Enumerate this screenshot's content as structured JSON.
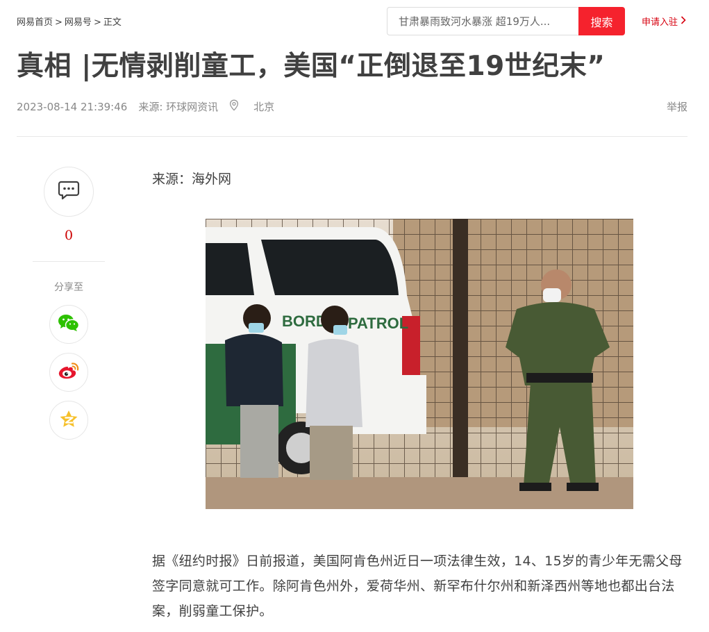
{
  "breadcrumb": {
    "home": "网易首页",
    "sep1": ">",
    "section": "网易号",
    "sep2": ">",
    "current": "正文"
  },
  "search": {
    "placeholder": "甘肃暴雨致河水暴涨 超19万人...",
    "button_label": "搜索"
  },
  "header": {
    "apply_label": "申请入驻",
    "apply_icon": "chevron-right-icon"
  },
  "article": {
    "title": "真相 |无情剥削童工，美国“正倒退至19世纪末”",
    "datetime": "2023-08-14 21:39:46",
    "source_meta": "来源: 环球网资讯",
    "location": "北京",
    "report_label": "举报",
    "source_line": "来源：海外网",
    "paragraph": "据《纽约时报》日前报道，美国阿肯色州近日一项法律生效，14、15岁的青少年无需父母签字同意就可工作。除阿肯色州外，爱荷华州、新罕布什尔州和新泽西州等地也都出台法案，削弱童工保护。"
  },
  "photo": {
    "vehicle_text": "BORDER PATROL",
    "vehicle_text_partial_left": "BORD",
    "vehicle_text_partial_right": "PATROL"
  },
  "sidebar": {
    "comment_count": "0",
    "share_label": "分享至",
    "share_icons": [
      "wechat-icon",
      "weibo-icon",
      "qzone-icon"
    ]
  },
  "colors": {
    "accent_red": "#f5222d",
    "apply_red": "#d7000f",
    "count_red": "#cc0000",
    "wechat_green": "#2dc100",
    "weibo_red": "#e6162d",
    "qzone_yellow": "#f6c02a"
  }
}
